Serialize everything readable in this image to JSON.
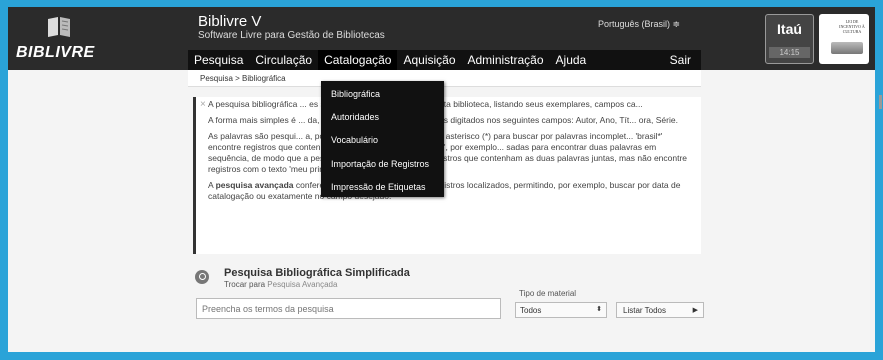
{
  "header": {
    "logo_text": "BIBLIVRE",
    "title": "Biblivre V",
    "subtitle": "Software Livre para Gestão de Bibliotecas",
    "language": "Português (Brasil) ≑"
  },
  "nav": {
    "items": [
      "Pesquisa",
      "Circulação",
      "Catalogação",
      "Aquisição",
      "Administração",
      "Ajuda"
    ],
    "exit": "Sair"
  },
  "sponsor": {
    "name": "Itaú",
    "time": "14:15"
  },
  "culture_logo_text": "LEI DE INCENTIVO À CULTURA",
  "breadcrumb": "Pesquisa > Bibliográfica",
  "dropdown": {
    "items": [
      "Bibliográfica",
      "Autoridades",
      "Vocabulário",
      "Importação de Registros",
      "Impressão de Etiquetas"
    ]
  },
  "info": {
    "close": "×",
    "p1": "A pesquisa bibliográfica ... es sobre os registros do acervo desta biblioteca, listando seus exemplares, campos ca...",
    "p2": "A forma mais simples é ... da, que buscará cada um dos termos digitados nos seguintes campos: Autor, Ano, Tít... ora, Série.",
    "p3": "As palavras são pesqui... a, porém é possível usar o caractere asterisco (*) para buscar por palavras incomplet... 'brasil*' encontre registros que contenham 'brasil', 'brasília' e 'brasileiro', por exemplo... sadas para encontrar duas palavras em sequência, de modo que a pesquisa \"meu amor\" encontre registros que contenham as duas palavras juntas, mas não encontre registros com o texto 'meu primeiro amor'.",
    "p4_strong": "pesquisa avançada",
    "p4_pre": "A ",
    "p4_post": " confere um maior controle sobre os registros localizados, permitindo, por exemplo, buscar por data de catalogação ou exatamente no campo desejado."
  },
  "search": {
    "title": "Pesquisa Bibliográfica Simplificada",
    "switch_prefix": "Trocar para ",
    "switch_link": "Pesquisa Avançada",
    "placeholder": "Preencha os termos da pesquisa",
    "type_label": "Tipo de material",
    "type_value": "Todos",
    "list_all": "Listar Todos"
  }
}
